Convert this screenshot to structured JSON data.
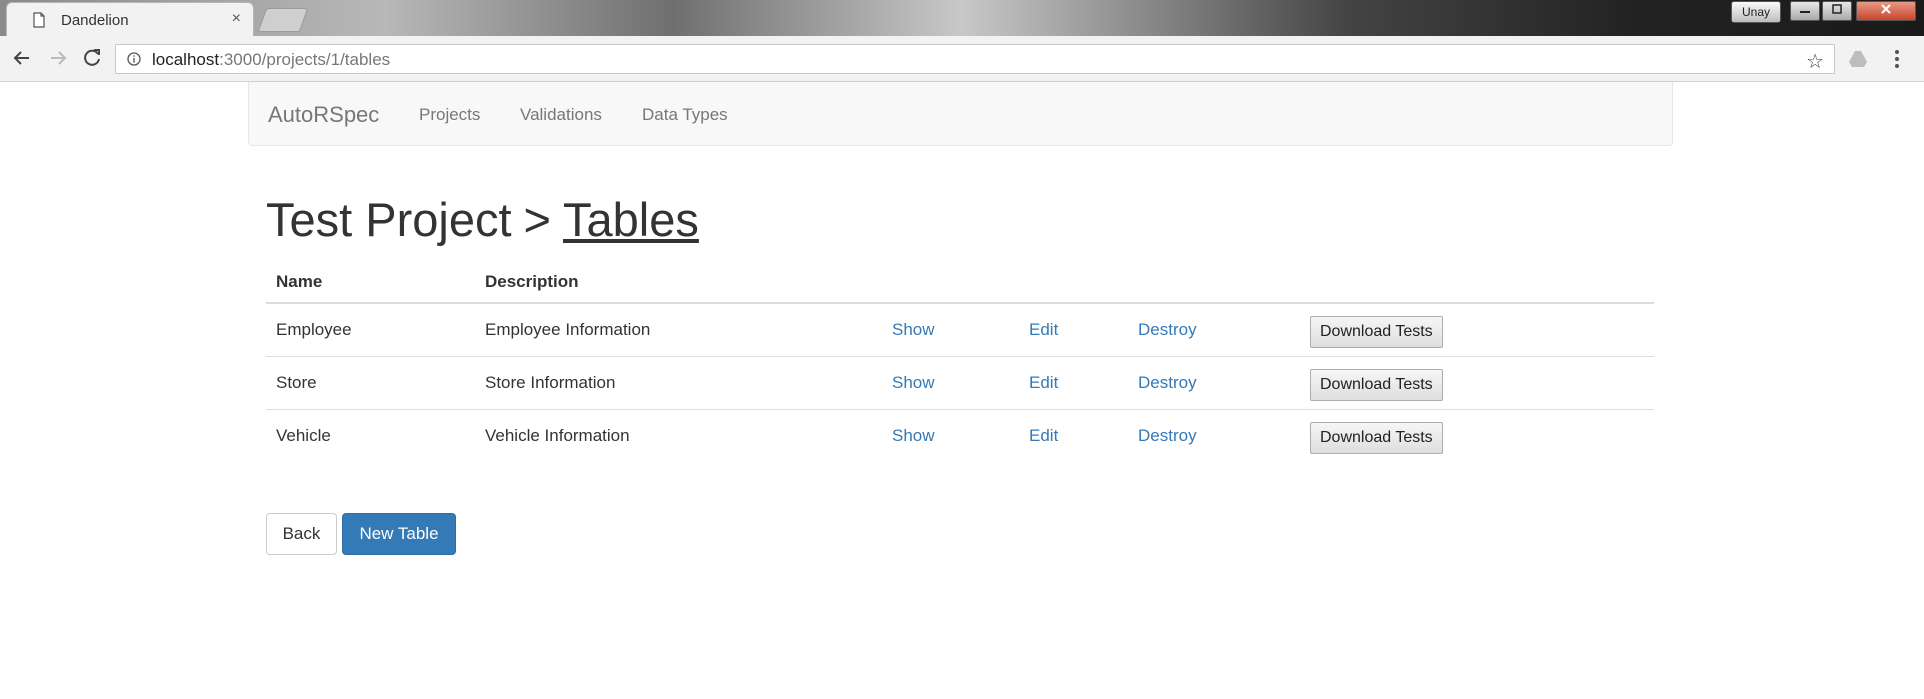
{
  "browser": {
    "tab_title": "Dandelion",
    "tab_close": "×",
    "profile_name": "Unay",
    "url_host": "localhost",
    "url_path": ":3000/projects/1/tables"
  },
  "navbar": {
    "brand": "AutoRSpec",
    "links": [
      "Projects",
      "Validations",
      "Data Types"
    ]
  },
  "page": {
    "project_name": "Test Project",
    "separator": ">",
    "section": "Tables"
  },
  "table": {
    "headers": [
      "Name",
      "Description"
    ],
    "rows": [
      {
        "name": "Employee",
        "description": "Employee Information",
        "show": "Show",
        "edit": "Edit",
        "destroy": "Destroy",
        "download": "Download Tests"
      },
      {
        "name": "Store",
        "description": "Store Information",
        "show": "Show",
        "edit": "Edit",
        "destroy": "Destroy",
        "download": "Download Tests"
      },
      {
        "name": "Vehicle",
        "description": "Vehicle Information",
        "show": "Show",
        "edit": "Edit",
        "destroy": "Destroy",
        "download": "Download Tests"
      }
    ]
  },
  "actions": {
    "back": "Back",
    "new_table": "New Table"
  },
  "colors": {
    "link": "#337ab7",
    "primary": "#337ab7",
    "navbar_bg": "#f8f8f8"
  }
}
